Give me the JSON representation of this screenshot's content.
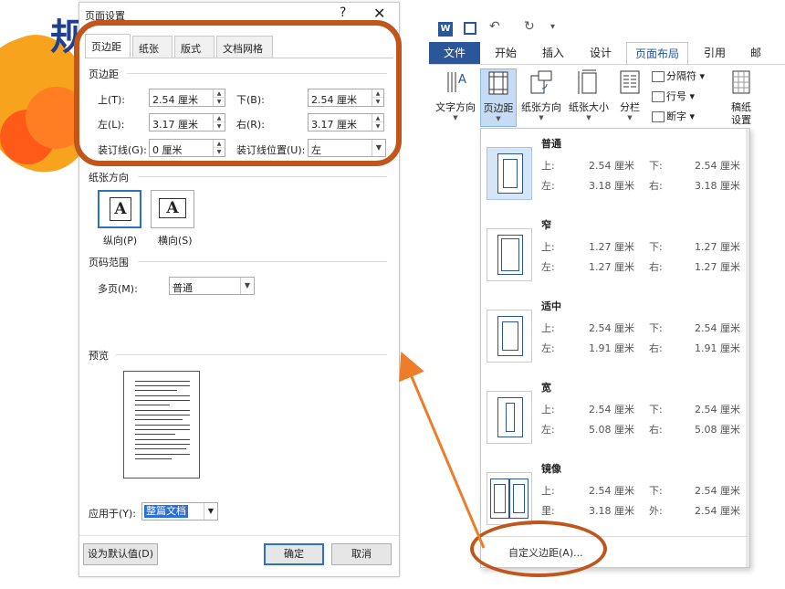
{
  "slide": {
    "title_fragment": "规"
  },
  "dialog": {
    "title": "页面设置",
    "help_label": "?",
    "close_label": "✕",
    "tabs": [
      "页边距",
      "纸张",
      "版式",
      "文档网格"
    ],
    "active_tab": "页边距",
    "margins_section": "页边距",
    "top_label": "上(T):",
    "top_value": "2.54 厘米",
    "bottom_label": "下(B):",
    "bottom_value": "2.54 厘米",
    "left_label": "左(L):",
    "left_value": "3.17 厘米",
    "right_label": "右(R):",
    "right_value": "3.17 厘米",
    "gutter_label": "装订线(G):",
    "gutter_value": "0 厘米",
    "gutter_pos_label": "装订线位置(U):",
    "gutter_pos_value": "左",
    "orientation_section": "纸张方向",
    "portrait_label": "纵向(P)",
    "landscape_label": "横向(S)",
    "orientation_selected": "纵向(P)",
    "orientation_glyph": "A",
    "pages_section": "页码范围",
    "multiple_pages_label": "多页(M):",
    "multiple_pages_value": "普通",
    "preview_section": "预览",
    "apply_to_label": "应用于(Y):",
    "apply_to_value": "整篇文档",
    "set_default_label": "设为默认值(D)",
    "ok_label": "确定",
    "cancel_label": "取消"
  },
  "ribbon": {
    "app_icon": "W",
    "quick_access": {
      "undo_glyph": "↶",
      "redo_glyph": "↻",
      "more_glyph": "▾"
    },
    "tabs": {
      "file": "文件",
      "home": "开始",
      "insert": "插入",
      "design": "设计",
      "layout": "页面布局",
      "references": "引用",
      "mailings": "邮"
    },
    "active_tab": "页面布局",
    "buttons": {
      "text_direction": "文字方向",
      "margins": "页边距",
      "orientation": "纸张方向",
      "size": "纸张大小",
      "columns": "分栏",
      "breaks": "分隔符",
      "line_numbers": "行号",
      "hyphenation": "断字",
      "manuscript": [
        "稿纸",
        "设置"
      ]
    }
  },
  "margins_menu": {
    "presets": [
      {
        "name": "普通",
        "r1": [
          "上:",
          "2.54 厘米",
          "下:",
          "2.54 厘米"
        ],
        "r2": [
          "左:",
          "3.18 厘米",
          "右:",
          "3.18 厘米"
        ]
      },
      {
        "name": "窄",
        "r1": [
          "上:",
          "1.27 厘米",
          "下:",
          "1.27 厘米"
        ],
        "r2": [
          "左:",
          "1.27 厘米",
          "右:",
          "1.27 厘米"
        ]
      },
      {
        "name": "适中",
        "r1": [
          "上:",
          "2.54 厘米",
          "下:",
          "2.54 厘米"
        ],
        "r2": [
          "左:",
          "1.91 厘米",
          "右:",
          "1.91 厘米"
        ]
      },
      {
        "name": "宽",
        "r1": [
          "上:",
          "2.54 厘米",
          "下:",
          "2.54 厘米"
        ],
        "r2": [
          "左:",
          "5.08 厘米",
          "右:",
          "5.08 厘米"
        ]
      },
      {
        "name": "镜像",
        "r1": [
          "上:",
          "2.54 厘米",
          "下:",
          "2.54 厘米"
        ],
        "r2": [
          "里:",
          "3.18 厘米",
          "外:",
          "2.54 厘米"
        ]
      }
    ],
    "selected": "普通",
    "custom_label": "自定义边距(A)..."
  },
  "colors": {
    "word_blue": "#2b579a",
    "annotation": "#c0561b",
    "selection": "#2a6fd6"
  }
}
